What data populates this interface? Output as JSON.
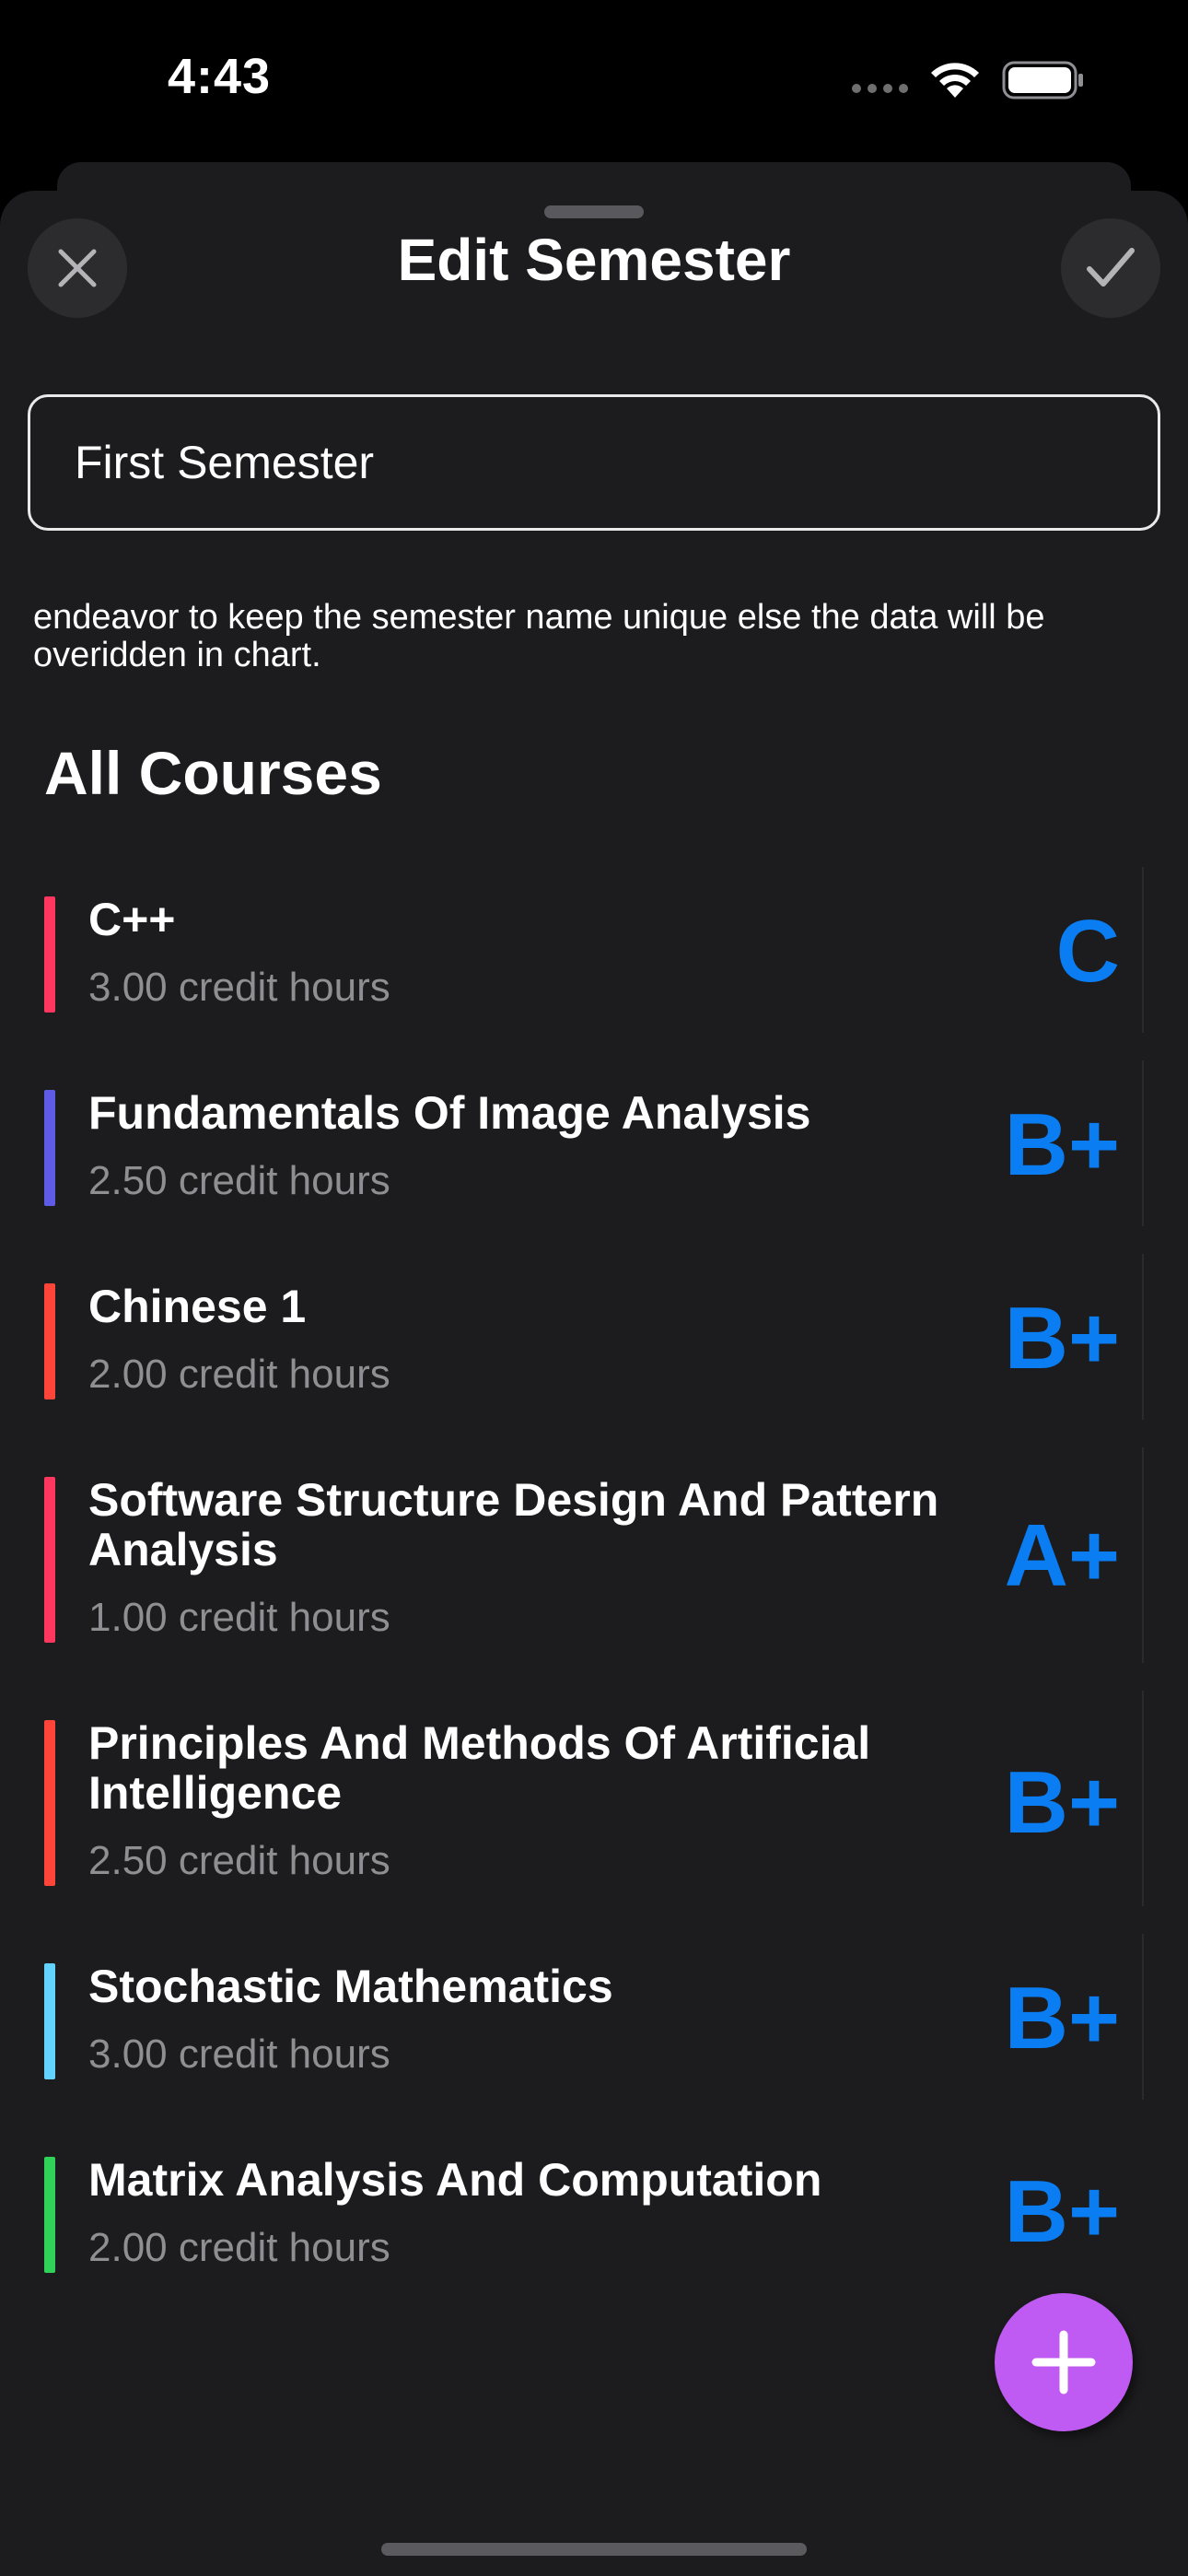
{
  "status_bar": {
    "time": "4:43",
    "icons": [
      "cellular-dots-icon",
      "wifi-icon",
      "battery-icon"
    ]
  },
  "header": {
    "title": "Edit Semester",
    "close_icon": "close-icon",
    "done_icon": "checkmark-icon"
  },
  "semester_name": {
    "value": "First Semester",
    "placeholder": ""
  },
  "hint_text": "endeavor to keep the semester name unique else the data will be overidden in chart.",
  "section_title": "All Courses",
  "courses": [
    {
      "name": "C++",
      "credits": "3.00 credit hours",
      "grade": "C",
      "color": "#ff375f"
    },
    {
      "name": "Fundamentals Of Image Analysis",
      "credits": "2.50 credit hours",
      "grade": "B+",
      "color": "#5e5ce6"
    },
    {
      "name": "Chinese 1",
      "credits": "2.00 credit hours",
      "grade": "B+",
      "color": "#ff453a"
    },
    {
      "name": "Software Structure Design And Pattern Analysis",
      "credits": "1.00 credit hours",
      "grade": "A+",
      "color": "#ff375f"
    },
    {
      "name": "Principles And Methods Of Artificial Intelligence",
      "credits": "2.50 credit hours",
      "grade": "B+",
      "color": "#ff453a"
    },
    {
      "name": "Stochastic Mathematics",
      "credits": "3.00 credit hours",
      "grade": "B+",
      "color": "#64d2ff"
    },
    {
      "name": "Matrix Analysis And Computation",
      "credits": "2.00 credit hours",
      "grade": "B+",
      "color": "#30d158"
    }
  ],
  "colors": {
    "background": "#1c1c1e",
    "grade": "#0a7df2",
    "fab": "#bf5af2",
    "secondary_text": "#8e8e93"
  },
  "fab_icon": "plus-icon"
}
